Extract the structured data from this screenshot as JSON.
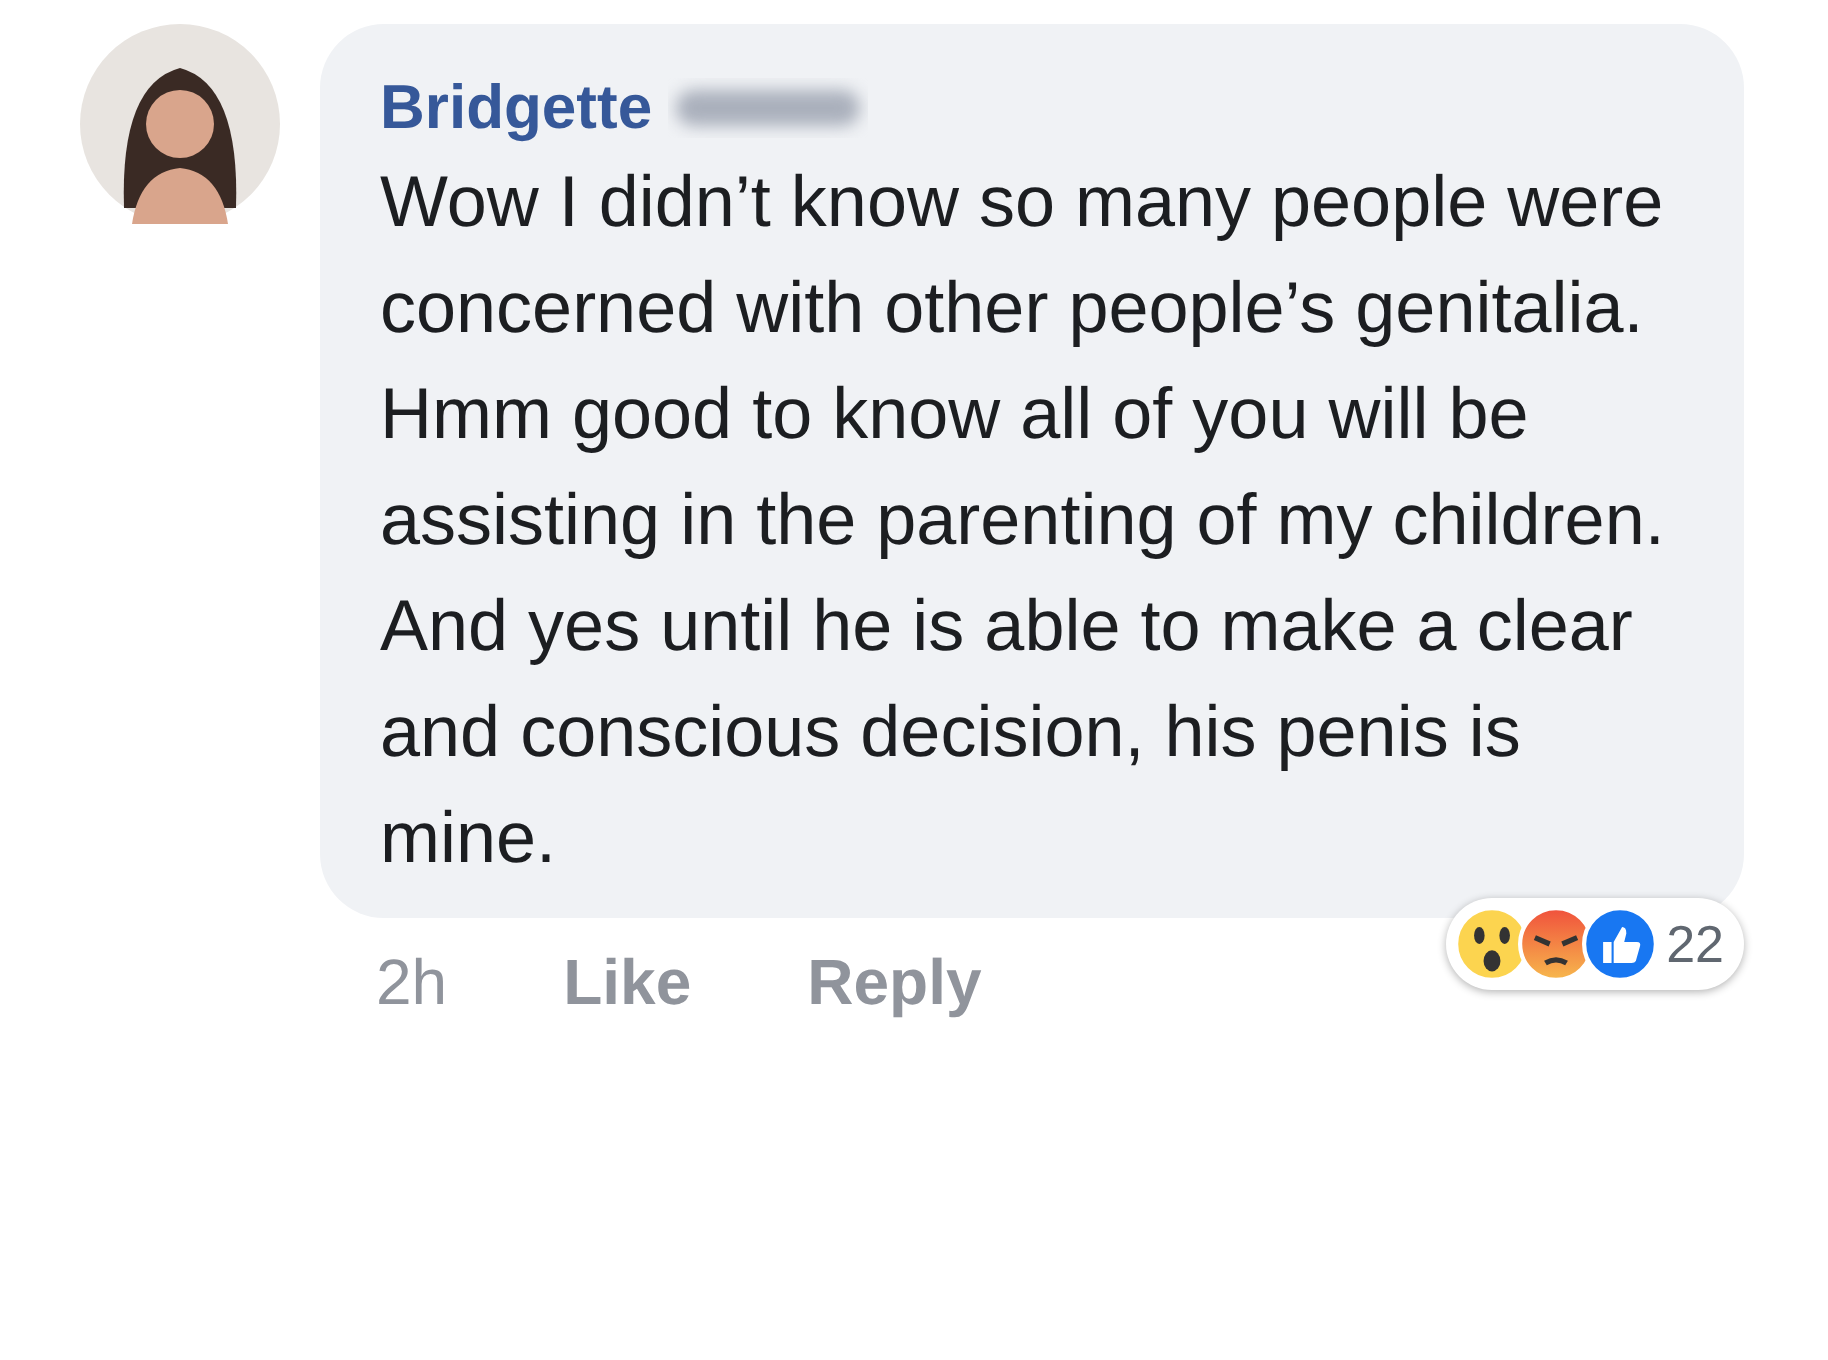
{
  "comment": {
    "author": "Bridgette",
    "text": "Wow I didn’t know so many people were concerned with other people’s genitalia. Hmm good to know all of you will be assisting in the parenting of my children. And yes until he is able to make a clear and conscious decision, his penis is mine.",
    "time": "2h",
    "actions": [
      "Like",
      "Reply"
    ],
    "reactions": [
      {
        "kind": "wow"
      },
      {
        "kind": "angry"
      },
      {
        "kind": "like"
      }
    ],
    "reaction_count": "22"
  }
}
